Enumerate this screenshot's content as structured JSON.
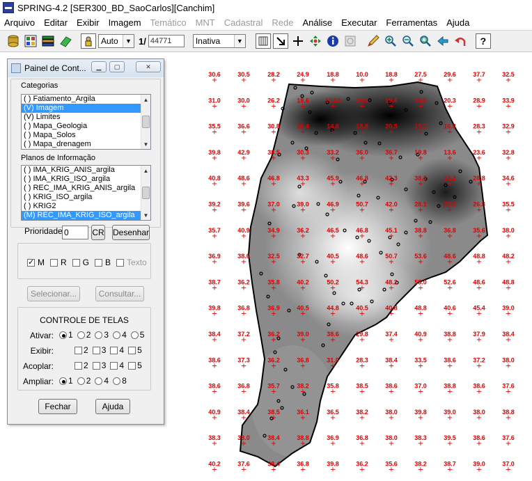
{
  "window": {
    "title": "SPRING-4.2 [SER300_BD_SaoCarlos][Canchim]"
  },
  "menu": [
    {
      "label": "Arquivo",
      "enabled": true
    },
    {
      "label": "Editar",
      "enabled": true
    },
    {
      "label": "Exibir",
      "enabled": true
    },
    {
      "label": "Imagem",
      "enabled": true
    },
    {
      "label": "Temático",
      "enabled": false
    },
    {
      "label": "MNT",
      "enabled": false
    },
    {
      "label": "Cadastral",
      "enabled": false
    },
    {
      "label": "Rede",
      "enabled": false
    },
    {
      "label": "Análise",
      "enabled": true
    },
    {
      "label": "Executar",
      "enabled": true
    },
    {
      "label": "Ferramentas",
      "enabled": true
    },
    {
      "label": "Ajuda",
      "enabled": true
    }
  ],
  "toolbar": {
    "zoom_mode": "Auto",
    "scale_prefix": "1/",
    "scale_value": "44771",
    "tool_state": "Inativa",
    "icons": [
      "database-icon",
      "grid-icon",
      "layers-icon",
      "eraser-icon",
      "user-select-icon",
      "draw-icon",
      "cross-icon",
      "pan-icon",
      "info-icon",
      "query-icon",
      "pencil-icon",
      "zoom-in-icon",
      "zoom-out-icon",
      "zoom-area-icon",
      "back-icon",
      "undo-icon",
      "help-icon"
    ]
  },
  "panel": {
    "title": "Painel de Cont...",
    "categories_label": "Categorias",
    "categories": [
      {
        "label": "( ) Fatiamento_Argila",
        "selected": false
      },
      {
        "label": "(V) Imagem",
        "selected": true
      },
      {
        "label": "(V) Limites",
        "selected": false
      },
      {
        "label": "( ) Mapa_Geologia",
        "selected": false
      },
      {
        "label": "( ) Mapa_Solos",
        "selected": false
      },
      {
        "label": "( ) Mapa_drenagem",
        "selected": false
      }
    ],
    "planes_label": "Planos de Informação",
    "planes": [
      {
        "label": "( ) IMA_KRIG_ANIS_argila",
        "selected": false
      },
      {
        "label": "( ) IMA_KRIG_ISO_argila",
        "selected": false
      },
      {
        "label": "( ) REC_IMA_KRIG_ANIS_argila",
        "selected": false
      },
      {
        "label": "( ) KRIG_ISO_argila",
        "selected": false
      },
      {
        "label": "( ) KRIG2",
        "selected": false
      },
      {
        "label": "(M) REC_IMA_KRIG_ISO_argila",
        "selected": true
      }
    ],
    "priority_label": "Prioridade:",
    "priority_value": "0",
    "cr_label": "CR",
    "draw_label": "Desenhar",
    "checkboxes": [
      {
        "label": "M",
        "checked": true,
        "enabled": true
      },
      {
        "label": "R",
        "checked": false,
        "enabled": true
      },
      {
        "label": "G",
        "checked": false,
        "enabled": true
      },
      {
        "label": "B",
        "checked": false,
        "enabled": true
      },
      {
        "label": "Texto",
        "checked": false,
        "enabled": false
      }
    ],
    "select_label": "Selecionar...",
    "query_label": "Consultar...",
    "screens_title": "CONTROLE DE TELAS",
    "activate_label": "Ativar:",
    "display_label": "Exibir:",
    "couple_label": "Acoplar:",
    "enlarge_label": "Ampliar:",
    "screen_numbers": [
      "1",
      "2",
      "3",
      "4",
      "5"
    ],
    "enlarge_options": [
      "1",
      "2",
      "4",
      "8"
    ],
    "close_label": "Fechar",
    "help_label": "Ajuda"
  },
  "grid_samples": [
    [
      "30.6",
      "30.5",
      "28.2",
      "24.9",
      "18.8",
      "10.0",
      "18.8",
      "27.5",
      "29.6",
      "37.7",
      "32.5"
    ],
    [
      "31.0",
      "30.0",
      "26.2",
      "18.6",
      "10.58",
      "18.8",
      "19.4",
      "19.8",
      "20.3",
      "28.9",
      "33.9"
    ],
    [
      "35.5",
      "36.6",
      "30.8",
      "20.4",
      "14.8",
      "18.8",
      "20.5",
      "19.2",
      "16.8",
      "28.3",
      "32.9"
    ],
    [
      "39.8",
      "42.9",
      "38.5",
      "30.3",
      "33.2",
      "36.0",
      "36.7",
      "19.8",
      "13.6",
      "23.6",
      "32.8"
    ],
    [
      "40.8",
      "48.6",
      "46.8",
      "43.3",
      "45.9",
      "46.8",
      "42.3",
      "38.3",
      "13.2",
      "28.8",
      "34.6"
    ],
    [
      "39.2",
      "39.6",
      "37.0",
      "39.0",
      "46.9",
      "50.7",
      "42.0",
      "28.1",
      "20.8",
      "26.8",
      "35.5"
    ],
    [
      "35.7",
      "40.9",
      "34.9",
      "36.2",
      "46.5",
      "46.8",
      "45.1",
      "38.8",
      "36.8",
      "35.6",
      "38.0"
    ],
    [
      "36.9",
      "38.0",
      "32.5",
      "32.7",
      "40.5",
      "48.6",
      "50.7",
      "53.6",
      "48.6",
      "48.8",
      "48.2"
    ],
    [
      "38.7",
      "36.2",
      "35.8",
      "40.2",
      "50.2",
      "54.3",
      "48.2",
      "55.0",
      "52.6",
      "48.6",
      "48.8"
    ],
    [
      "39.8",
      "36.8",
      "36.9",
      "40.5",
      "44.8",
      "40.5",
      "40.8",
      "48.8",
      "40.6",
      "45.4",
      "39.0"
    ],
    [
      "38.4",
      "37.2",
      "36.2",
      "39.0",
      "38.6",
      "29.8",
      "37.4",
      "40.9",
      "38.8",
      "37.9",
      "38.4"
    ],
    [
      "38.6",
      "37.3",
      "36.2",
      "36.8",
      "31.0",
      "28.3",
      "38.4",
      "33.5",
      "38.6",
      "37.2",
      "38.0"
    ],
    [
      "38.6",
      "36.8",
      "35.7",
      "38.2",
      "35.8",
      "38.5",
      "38.6",
      "37.0",
      "38.8",
      "38.6",
      "37.6"
    ],
    [
      "40.9",
      "38.4",
      "38.5",
      "36.1",
      "36.5",
      "38.2",
      "38.0",
      "39.8",
      "39.0",
      "38.0",
      "38.8"
    ],
    [
      "38.3",
      "38.0",
      "38.4",
      "38.8",
      "36.9",
      "36.8",
      "38.0",
      "38.3",
      "39.5",
      "38.6",
      "37.6"
    ],
    [
      "40.2",
      "37.6",
      "38.4",
      "36.8",
      "39.8",
      "36.2",
      "35.6",
      "38.2",
      "38.7",
      "39.0",
      "37.0"
    ]
  ]
}
